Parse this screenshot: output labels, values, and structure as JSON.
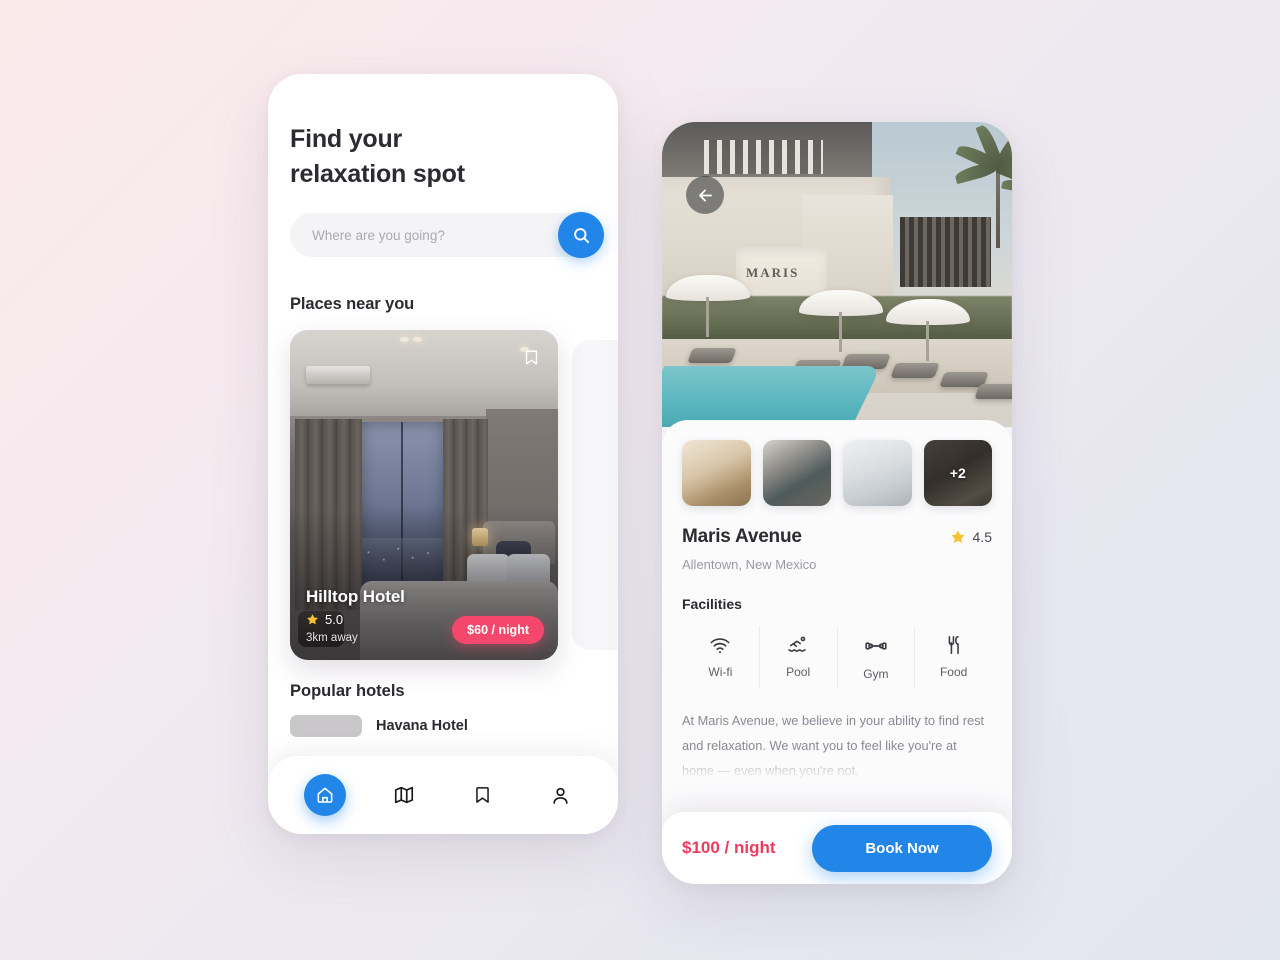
{
  "home": {
    "headline_line1": "Find your",
    "headline_line2": "relaxation spot",
    "search": {
      "placeholder": "Where are you going?",
      "value": "",
      "icon": "search-icon"
    },
    "near_you_title": "Places near you",
    "featured_card": {
      "name": "Hilltop Hotel",
      "rating": "5.0",
      "distance": "3km away",
      "price": "$60 / night",
      "bookmark_icon": "bookmark-icon",
      "star_icon": "star-icon"
    },
    "popular_title": "Popular hotels",
    "popular_items": [
      {
        "name": "Havana Hotel"
      }
    ],
    "nav": [
      {
        "name": "home",
        "icon": "home-icon",
        "active": true
      },
      {
        "name": "map",
        "icon": "map-icon",
        "active": false
      },
      {
        "name": "saved",
        "icon": "bookmark-icon",
        "active": false
      },
      {
        "name": "profile",
        "icon": "person-icon",
        "active": false
      }
    ]
  },
  "detail": {
    "back_icon": "arrow-left-icon",
    "hero_sign": "MARIS",
    "thumbnails": [
      {
        "label": ""
      },
      {
        "label": ""
      },
      {
        "label": ""
      },
      {
        "label": "+2"
      }
    ],
    "title": "Maris Avenue",
    "rating": "4.5",
    "star_icon": "star-icon",
    "location": "Allentown, New Mexico",
    "facilities_title": "Facilities",
    "facilities": [
      {
        "label": "Wi-fi",
        "icon": "wifi-icon"
      },
      {
        "label": "Pool",
        "icon": "pool-icon"
      },
      {
        "label": "Gym",
        "icon": "dumbbell-icon"
      },
      {
        "label": "Food",
        "icon": "cutlery-icon"
      }
    ],
    "description": "At Maris Avenue, we believe in your ability to find rest and relaxation. We want you to feel like you're at home — even when you're not.",
    "price": "$100 / night",
    "book_label": "Book Now"
  },
  "colors": {
    "accent_blue": "#2186e8",
    "price_pink": "#f5466b",
    "price_red": "#ef3b5e",
    "star_yellow": "#f5c335",
    "text_dark": "#2b2b31",
    "text_muted": "#9a9aa3"
  }
}
